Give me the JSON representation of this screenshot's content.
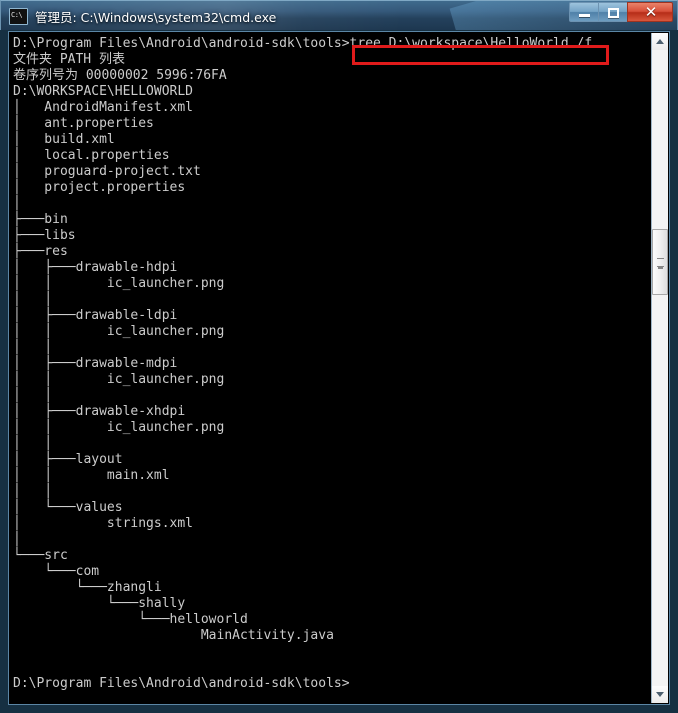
{
  "window": {
    "title": "管理员: C:\\Windows\\system32\\cmd.exe",
    "icon": "cmd-icon",
    "controls": {
      "minimize_label": "",
      "maximize_label": "",
      "close_label": "✕"
    }
  },
  "console": {
    "prompt_path": "D:\\Program Files\\Android\\android-sdk\\tools>",
    "command": "tree D:\\workspace\\HelloWorld /f",
    "highlight_color": "#e01b1b",
    "background_color": "#000000",
    "text_color": "#cccccc",
    "lines": [
      "D:\\Program Files\\Android\\android-sdk\\tools>tree D:\\workspace\\HelloWorld /f",
      "文件夹 PATH 列表",
      "卷序列号为 00000002 5996:76FA",
      "D:\\WORKSPACE\\HELLOWORLD",
      "│   AndroidManifest.xml",
      "│   ant.properties",
      "│   build.xml",
      "│   local.properties",
      "│   proguard-project.txt",
      "│   project.properties",
      "│",
      "├───bin",
      "├───libs",
      "├───res",
      "│   ├───drawable-hdpi",
      "│   │       ic_launcher.png",
      "│   │",
      "│   ├───drawable-ldpi",
      "│   │       ic_launcher.png",
      "│   │",
      "│   ├───drawable-mdpi",
      "│   │       ic_launcher.png",
      "│   │",
      "│   ├───drawable-xhdpi",
      "│   │       ic_launcher.png",
      "│   │",
      "│   ├───layout",
      "│   │       main.xml",
      "│   │",
      "│   └───values",
      "│           strings.xml",
      "│",
      "└───src",
      "    └───com",
      "        └───zhangli",
      "            └───shally",
      "                └───helloworld",
      "                        MainActivity.java",
      "",
      "",
      "D:\\Program Files\\Android\\android-sdk\\tools>"
    ]
  },
  "scrollbar": {
    "up_arrow": "▲",
    "down_arrow": "▼",
    "thumb_position_pct": 29
  }
}
